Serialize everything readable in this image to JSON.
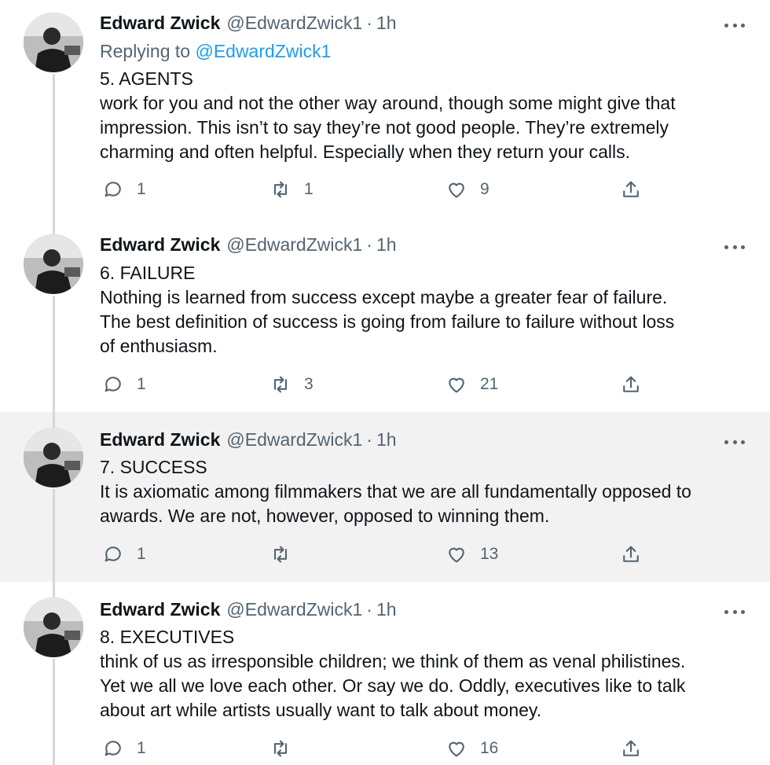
{
  "author": {
    "name": "Edward Zwick",
    "handle": "@EdwardZwick1",
    "separator": "·",
    "time": "1h"
  },
  "tweets": [
    {
      "replying_prefix": "Replying to",
      "replying_to": "@EdwardZwick1",
      "title": "5. AGENTS",
      "lines": [
        "work for you and not the other way around, though some might give that",
        "impression. This isn’t to say they’re not good people. They’re extremely",
        "charming and often helpful. Especially when they return your calls."
      ],
      "replies": "1",
      "retweets": "1",
      "likes": "9"
    },
    {
      "title": "6. FAILURE",
      "lines": [
        "Nothing is learned from success except maybe a greater fear of failure.",
        "The best definition of success is going from failure to failure without loss",
        "of enthusiasm."
      ],
      "replies": "1",
      "retweets": "3",
      "likes": "21"
    },
    {
      "title": "7. SUCCESS",
      "lines": [
        "It is axiomatic among filmmakers that we are all fundamentally opposed to",
        "awards. We are not, however, opposed to winning them."
      ],
      "replies": "1",
      "retweets": "",
      "likes": "13"
    },
    {
      "title": "8. EXECUTIVES",
      "lines": [
        "think of us as irresponsible children; we think of them as venal philistines.",
        "Yet we all we love each other. Or say we do. Oddly, executives like to talk",
        "about art while artists usually want to talk about money."
      ],
      "replies": "1",
      "retweets": "",
      "likes": "16"
    }
  ],
  "icons": {
    "reply": "speech-bubble-icon",
    "retweet": "retweet-arrows-icon",
    "like": "heart-outline-icon",
    "share": "share-upload-icon",
    "more": "more-dots-icon"
  },
  "colors": {
    "text": "#0f1419",
    "muted": "#536471",
    "link": "#1d9bf0",
    "thread_line": "#cfd9de",
    "highlight_bg": "#f2f2f2"
  }
}
